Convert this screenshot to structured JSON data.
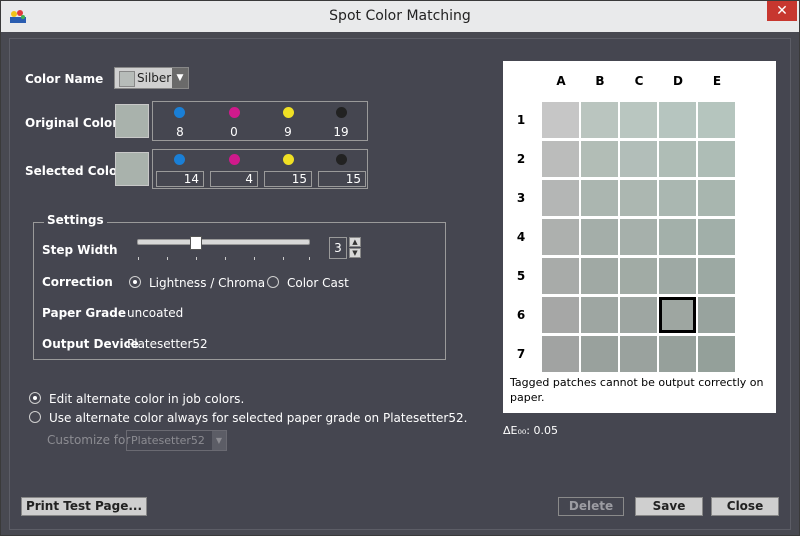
{
  "window": {
    "title": "Spot Color Matching",
    "close_glyph": "✕"
  },
  "color_name": {
    "label": "Color Name",
    "value": "Silber"
  },
  "original": {
    "label": "Original Color",
    "values": [
      "8",
      "0",
      "9",
      "19"
    ]
  },
  "selected": {
    "label": "Selected Color",
    "values": [
      "14",
      "4",
      "15",
      "15"
    ]
  },
  "inks": [
    {
      "name": "cyan",
      "color": "#1a7fd6"
    },
    {
      "name": "magenta",
      "color": "#d01a8c"
    },
    {
      "name": "yellow",
      "color": "#f0e024"
    },
    {
      "name": "black",
      "color": "#222222"
    }
  ],
  "settings": {
    "legend": "Settings",
    "step_width_label": "Step Width",
    "step_width_value": "3",
    "correction_label": "Correction",
    "correction_options": [
      "Lightness / Chroma",
      "Color Cast"
    ],
    "paper_grade_label": "Paper Grade",
    "paper_grade_value": "uncoated",
    "output_device_label": "Output Device",
    "output_device_value": "Platesetter52"
  },
  "options": {
    "edit_alternate": "Edit alternate color in job colors.",
    "use_alternate": "Use alternate color always for selected paper grade on Platesetter52.",
    "customize_label": "Customize for",
    "customize_value": "Platesetter52"
  },
  "grid": {
    "columns": [
      "A",
      "B",
      "C",
      "D",
      "E"
    ],
    "rows": [
      "1",
      "2",
      "3",
      "4",
      "5",
      "6",
      "7"
    ],
    "selected": "D6",
    "colors": [
      [
        "#c6c6c6",
        "#bac5bf",
        "#b9c6c0",
        "#b6c5bf",
        "#b5c5be"
      ],
      [
        "#bbbcbb",
        "#b2bdb6",
        "#b2beb9",
        "#afbdb6",
        "#aebdb6"
      ],
      [
        "#b4b6b5",
        "#abb6b0",
        "#acb7b1",
        "#aab7b1",
        "#a8b6af"
      ],
      [
        "#adb0ae",
        "#a4aea9",
        "#a6b0ab",
        "#a3b0aa",
        "#a1afa9"
      ],
      [
        "#a8aba9",
        "#a0a9a4",
        "#a1aba5",
        "#9ea9a4",
        "#9ca9a3"
      ],
      [
        "#a6a7a6",
        "#9ea6a2",
        "#9ea6a2",
        "#9ea6a1",
        "#98a39e"
      ],
      [
        "#a1a3a2",
        "#99a19d",
        "#9aa29e",
        "#96a09b",
        "#94a09a"
      ]
    ],
    "note": "Tagged patches cannot be output correctly on paper.",
    "delta_e": "ΔE₀₀: 0.05"
  },
  "buttons": {
    "print_test_page": "Print Test Page...",
    "delete": "Delete",
    "save": "Save",
    "close": "Close"
  }
}
